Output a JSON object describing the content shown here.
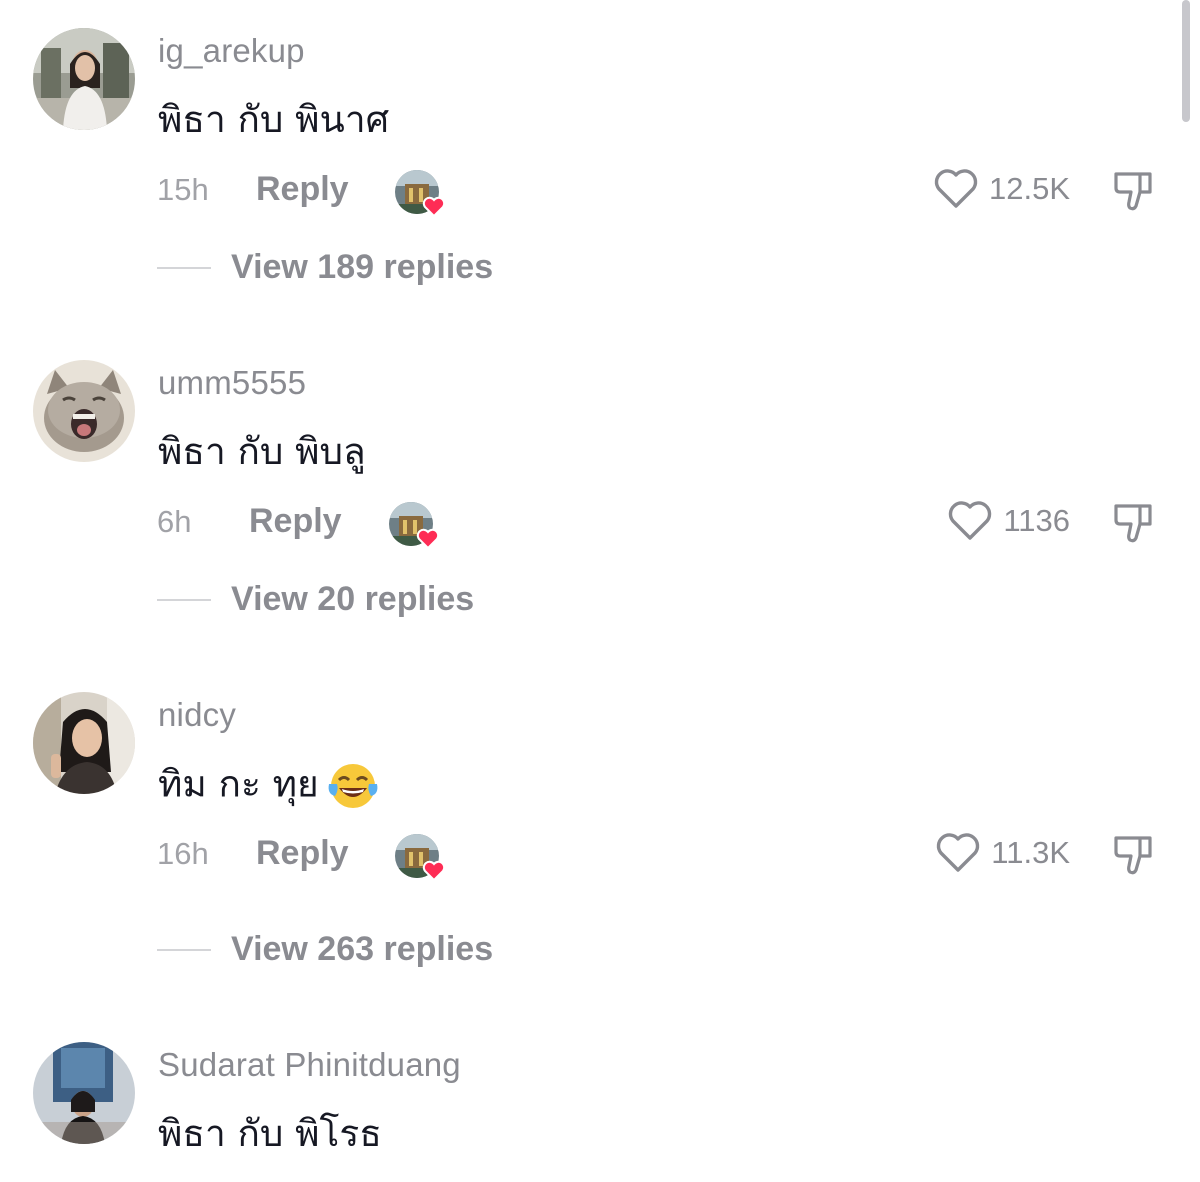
{
  "comments": [
    {
      "username": "ig_arekup",
      "text": "พิธา กับ พินาศ",
      "time": "15h",
      "reply_label": "Reply",
      "likes": "12.5K",
      "view_replies": "View 189 replies"
    },
    {
      "username": "umm5555",
      "text": "พิธา กับ พิบลู",
      "time": "6h",
      "reply_label": "Reply",
      "likes": "1136",
      "view_replies": "View 20 replies"
    },
    {
      "username": "nidcy",
      "text": "ทิม กะ ทุย",
      "emoji": "face-with-tears-of-joy",
      "time": "16h",
      "reply_label": "Reply",
      "likes": "11.3K",
      "view_replies": "View 263 replies"
    },
    {
      "username": "Sudarat Phinitduang",
      "text": "พิธา กับ พิโรธ"
    }
  ],
  "icons": {
    "like": "heart-outline-icon",
    "dislike": "thumbs-down-icon",
    "creator_liked": "creator-liked-heart-badge"
  },
  "colors": {
    "text_primary": "#161823",
    "text_secondary": "#8a8b91",
    "heart_badge": "#fe2c55"
  }
}
